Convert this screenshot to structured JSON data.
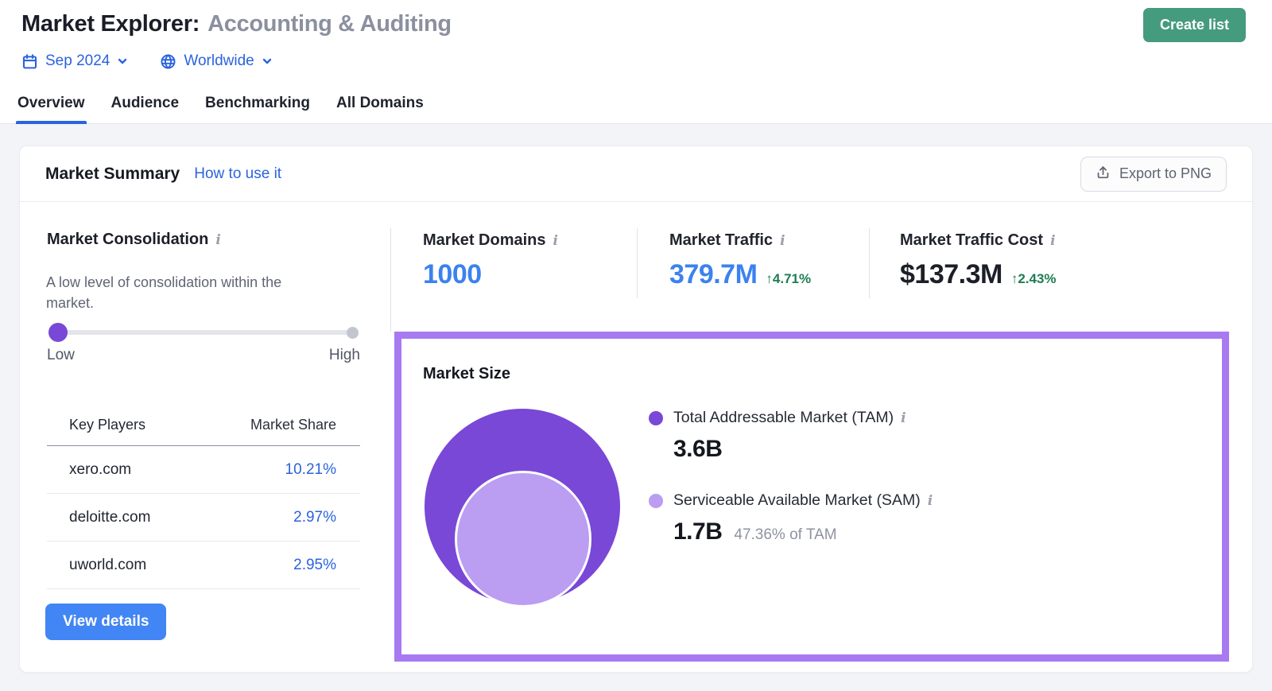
{
  "theme": {
    "blue_link": "#2b63dd",
    "blue_metric": "#3c82ee",
    "green_text": "#1e7d52",
    "green_btn": "#459b7e",
    "blue_btn": "#4285f4",
    "purple_tam": "#7948d6",
    "purple_sam": "#bb9df2",
    "purple_border": "#a87af2"
  },
  "icons": {
    "date_icon": "calendar",
    "region_icon": "globe",
    "export_icon": "upload-arrow-tray",
    "info_icon": "italic-i",
    "dropdown_icon": "chevron-down"
  },
  "header": {
    "title_prefix": "Market Explorer:",
    "title_market": "Accounting & Auditing",
    "create_list_label": "Create list",
    "date_selector": "Sep 2024",
    "region_selector": "Worldwide",
    "tabs": [
      {
        "label": "Overview",
        "active": true
      },
      {
        "label": "Audience",
        "active": false
      },
      {
        "label": "Benchmarking",
        "active": false
      },
      {
        "label": "All Domains",
        "active": false
      }
    ]
  },
  "card": {
    "title": "Market Summary",
    "help_link": "How to use it",
    "export_button": "Export to PNG"
  },
  "consolidation": {
    "title": "Market Consolidation",
    "description": "A low level of consolidation within the market.",
    "slider_low_label": "Low",
    "slider_high_label": "High",
    "slider_position": "low"
  },
  "key_players": {
    "col_player": "Key Players",
    "col_share": "Market Share",
    "rows": [
      {
        "domain": "xero.com",
        "share": "10.21%"
      },
      {
        "domain": "deloitte.com",
        "share": "2.97%"
      },
      {
        "domain": "uworld.com",
        "share": "2.95%"
      }
    ],
    "view_details_label": "View details"
  },
  "stats": [
    {
      "label": "Market Domains",
      "value": "1000",
      "change": ""
    },
    {
      "label": "Market Traffic",
      "value": "379.7M",
      "change": "↑4.71%"
    },
    {
      "label": "Market Traffic Cost",
      "value": "$137.3M",
      "change": "↑2.43%"
    }
  ],
  "market_size": {
    "title": "Market Size",
    "tam": {
      "label": "Total Addressable Market (TAM)",
      "value": "3.6B"
    },
    "sam": {
      "label": "Serviceable Available Market (SAM)",
      "value": "1.7B",
      "share_of_tam": "47.36% of TAM"
    }
  }
}
